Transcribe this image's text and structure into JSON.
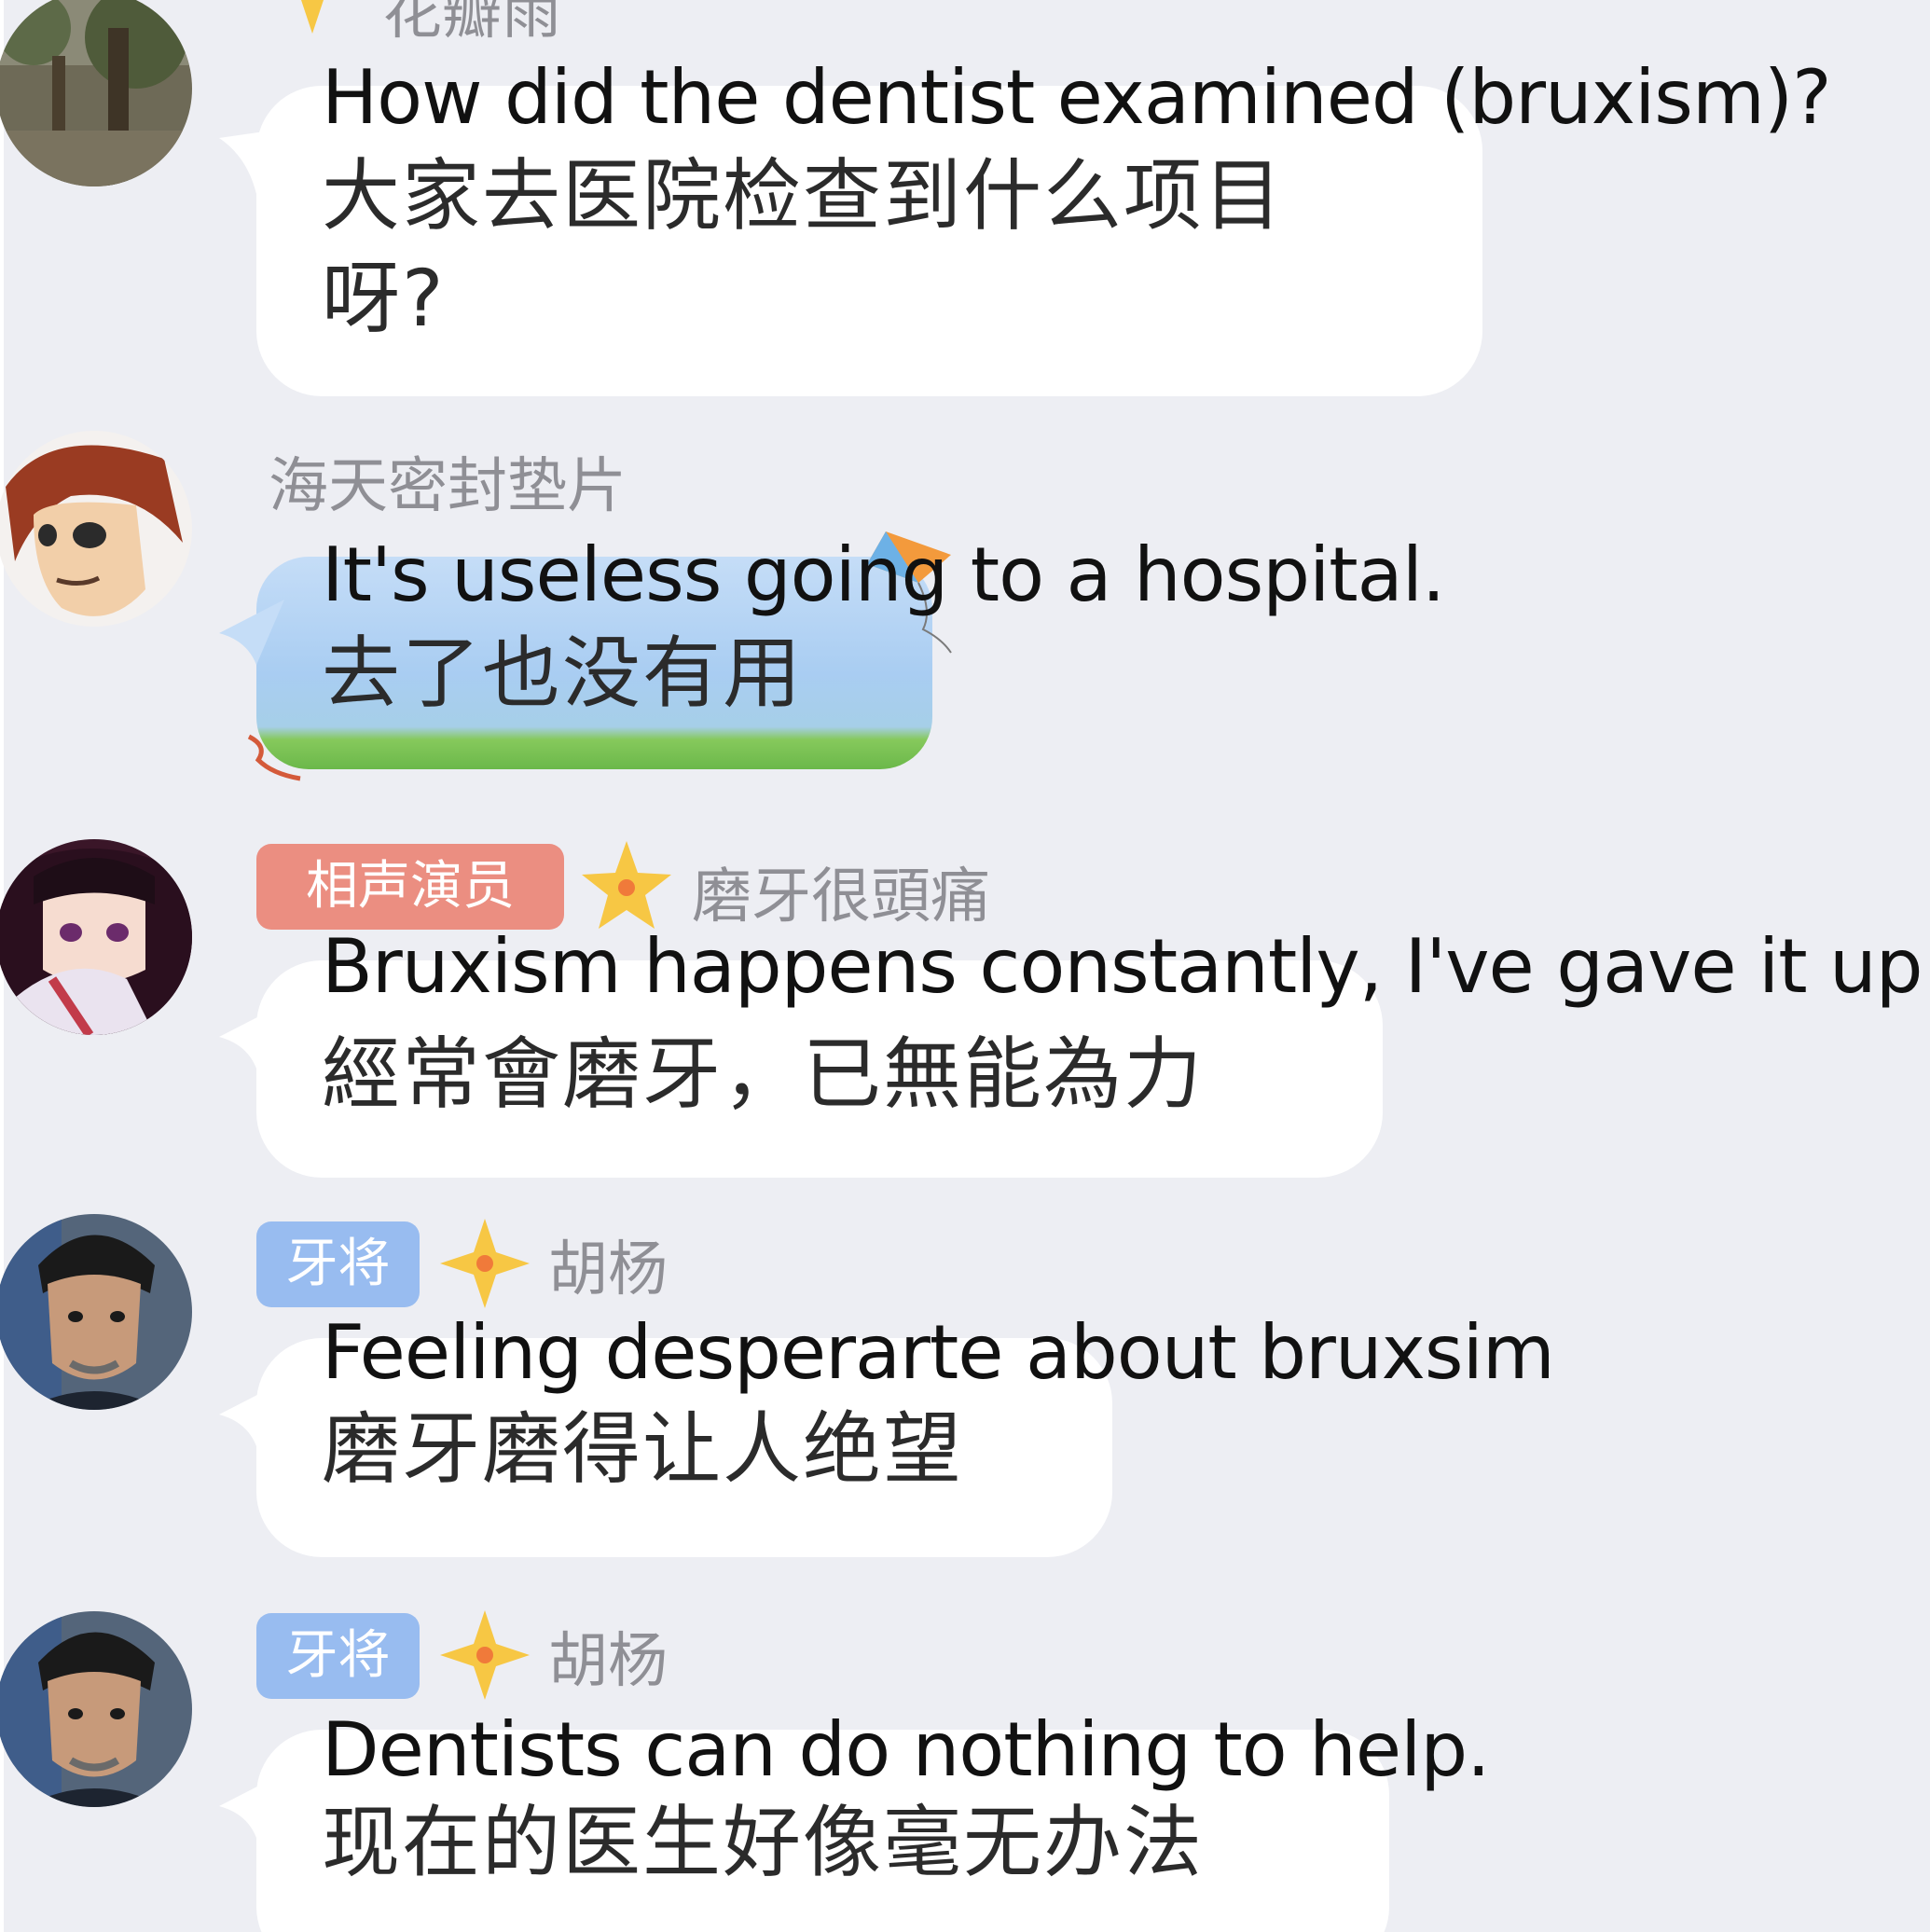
{
  "page": {
    "background": "#edeef3",
    "bubble_color": "#ffffff"
  },
  "messages": [
    {
      "id": "m1",
      "name": "花瓣雨",
      "english": "How did the dentist examined (bruxism)?",
      "chinese_line1": "大家去医院检查到什么项目",
      "chinese_line2": "呀?",
      "avatar_icon": "tree-photo-avatar-icon"
    },
    {
      "id": "m2",
      "name": "海天密封垫片",
      "english": "It's useless going to a hospital.",
      "chinese_line1": "去了也没有用",
      "avatar_icon": "anime-boy-avatar-icon"
    },
    {
      "id": "m3",
      "tag": "相声演员",
      "tag_color": "#eb8e81",
      "name": "磨牙很頭痛",
      "english": "Bruxism happens constantly, I've gave it up...",
      "chinese_line1": "經常會磨牙，已無能為力",
      "avatar_icon": "anime-girl-avatar-icon"
    },
    {
      "id": "m4",
      "tag": "牙将",
      "tag_color": "#98bcf0",
      "name": "胡杨",
      "english": "Feeling desperarte about bruxsim",
      "chinese_line1": "磨牙磨得让人绝望",
      "avatar_icon": "man-cartoon-avatar-icon"
    },
    {
      "id": "m5",
      "tag": "牙将",
      "tag_color": "#98bcf0",
      "name": "胡杨",
      "english": "Dentists can do nothing to help.",
      "chinese_line1": "现在的医生好像毫无办法",
      "avatar_icon": "man-cartoon-avatar-icon"
    }
  ]
}
